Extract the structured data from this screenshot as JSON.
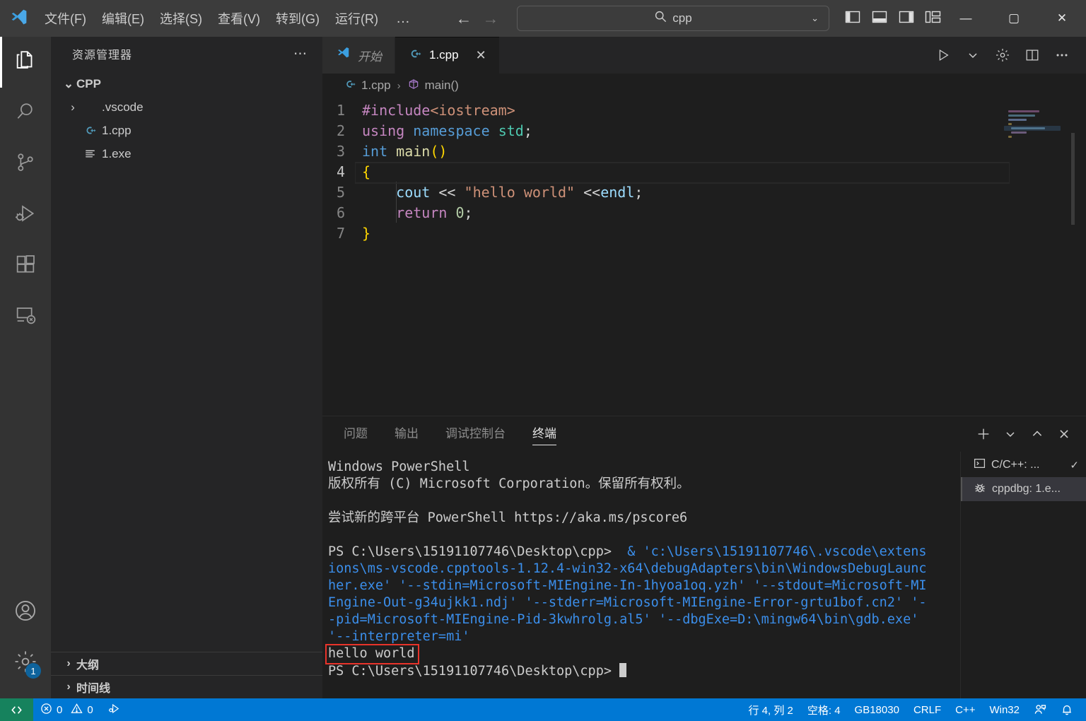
{
  "titlebar": {
    "logo": "vscode-logo",
    "menus": [
      "文件(F)",
      "编辑(E)",
      "选择(S)",
      "查看(V)",
      "转到(G)",
      "运行(R)"
    ],
    "more": "…",
    "nav_back": "←",
    "nav_forward": "→",
    "search": {
      "value": "cpp",
      "icon": "search-icon",
      "chevron": "⌄"
    },
    "layout_icons": [
      "toggle-primary-sidebar-icon",
      "toggle-panel-icon",
      "toggle-secondary-sidebar-icon",
      "customize-layout-icon"
    ],
    "window_controls": {
      "minimize": "—",
      "maximize": "▢",
      "close": "✕"
    }
  },
  "activitybar": {
    "items": [
      {
        "name": "explorer",
        "icon": "files-icon",
        "active": true
      },
      {
        "name": "search",
        "icon": "search-icon",
        "active": false
      },
      {
        "name": "source-control",
        "icon": "source-control-icon",
        "active": false
      },
      {
        "name": "run-and-debug",
        "icon": "run-debug-icon",
        "active": false
      },
      {
        "name": "extensions",
        "icon": "extensions-icon",
        "active": false
      },
      {
        "name": "remote-explorer",
        "icon": "remote-icon",
        "active": false
      }
    ],
    "bottom": [
      {
        "name": "accounts",
        "icon": "account-icon",
        "badge": ""
      },
      {
        "name": "settings",
        "icon": "gear-icon",
        "badge": "1"
      }
    ]
  },
  "sidebar": {
    "title": "资源管理器",
    "more": "⋯",
    "root": {
      "label": "CPP",
      "twisty": "⌄"
    },
    "files": [
      {
        "label": ".vscode",
        "twisty": "›",
        "icon": "folder-icon",
        "indent": 36
      },
      {
        "label": "1.cpp",
        "twisty": "",
        "icon": "cpp-file-icon",
        "indent": 36
      },
      {
        "label": "1.exe",
        "twisty": "",
        "icon": "exe-file-icon",
        "indent": 36
      }
    ],
    "sections": [
      {
        "label": "大纲",
        "twisty": "›"
      },
      {
        "label": "时间线",
        "twisty": "›"
      }
    ]
  },
  "editor": {
    "tabs": [
      {
        "label": "开始",
        "icon": "vscode-logo-icon",
        "active": false,
        "italic": true,
        "closable": false
      },
      {
        "label": "1.cpp",
        "icon": "cpp-file-icon",
        "active": true,
        "italic": false,
        "closable": true,
        "close": "✕"
      }
    ],
    "actions": [
      {
        "name": "run-code-button",
        "icon": "play-icon"
      },
      {
        "name": "run-options-dropdown",
        "icon": "chevron-down-icon"
      },
      {
        "name": "editor-settings-button",
        "icon": "gear-icon"
      },
      {
        "name": "split-editor-button",
        "icon": "split-editor-icon"
      },
      {
        "name": "more-actions-button",
        "icon": "ellipsis-icon"
      }
    ],
    "breadcrumb": [
      {
        "label": "1.cpp",
        "icon": "cpp-file-icon"
      },
      {
        "label": "main()",
        "icon": "symbol-method-icon"
      }
    ],
    "breadcrumb_separator": "›",
    "lines": [
      {
        "n": "1",
        "tokens": [
          {
            "t": "#include",
            "c": "t-pp"
          },
          {
            "t": "<iostream>",
            "c": "t-str2"
          }
        ]
      },
      {
        "n": "2",
        "tokens": [
          {
            "t": "using",
            "c": "t-kw"
          },
          {
            "t": " ",
            "c": "t-op"
          },
          {
            "t": "namespace",
            "c": "t-kw2"
          },
          {
            "t": " ",
            "c": "t-op"
          },
          {
            "t": "std",
            "c": "t-ns"
          },
          {
            "t": ";",
            "c": "t-op"
          }
        ]
      },
      {
        "n": "3",
        "tokens": [
          {
            "t": "int",
            "c": "t-kw2"
          },
          {
            "t": " ",
            "c": "t-op"
          },
          {
            "t": "main",
            "c": "t-fn"
          },
          {
            "t": "()",
            "c": "t-br"
          }
        ]
      },
      {
        "n": "4",
        "tokens": [
          {
            "t": "{",
            "c": "t-br"
          }
        ],
        "current": true
      },
      {
        "n": "5",
        "tokens": [
          {
            "t": "    ",
            "c": "t-op"
          },
          {
            "t": "cout",
            "c": "t-var"
          },
          {
            "t": " ",
            "c": "t-op"
          },
          {
            "t": "<<",
            "c": "t-op"
          },
          {
            "t": " ",
            "c": "t-op"
          },
          {
            "t": "\"hello world\"",
            "c": "t-str"
          },
          {
            "t": " ",
            "c": "t-op"
          },
          {
            "t": "<<",
            "c": "t-op"
          },
          {
            "t": "endl",
            "c": "t-var"
          },
          {
            "t": ";",
            "c": "t-op"
          }
        ]
      },
      {
        "n": "6",
        "tokens": [
          {
            "t": "    ",
            "c": "t-op"
          },
          {
            "t": "return",
            "c": "t-kw"
          },
          {
            "t": " ",
            "c": "t-op"
          },
          {
            "t": "0",
            "c": "t-num"
          },
          {
            "t": ";",
            "c": "t-op"
          }
        ]
      },
      {
        "n": "7",
        "tokens": [
          {
            "t": "}",
            "c": "t-br"
          }
        ]
      }
    ]
  },
  "panel": {
    "tabs": [
      {
        "label": "问题",
        "active": false
      },
      {
        "label": "输出",
        "active": false
      },
      {
        "label": "调试控制台",
        "active": false
      },
      {
        "label": "终端",
        "active": true
      }
    ],
    "actions": [
      {
        "name": "new-terminal-button",
        "icon": "plus-icon"
      },
      {
        "name": "terminal-profile-dropdown",
        "icon": "chevron-down-icon"
      },
      {
        "name": "maximize-panel-button",
        "icon": "chevron-up-icon"
      },
      {
        "name": "close-panel-button",
        "icon": "close-icon"
      }
    ],
    "terminal_lines": [
      {
        "text": "Windows PowerShell",
        "color": "default"
      },
      {
        "text": "版权所有 (C) Microsoft Corporation。保留所有权利。",
        "color": "default"
      },
      {
        "text": "",
        "color": "default"
      },
      {
        "text": "尝试新的跨平台 PowerShell https://aka.ms/pscore6",
        "color": "default"
      },
      {
        "text": "",
        "color": "default"
      },
      {
        "text": "PS C:\\Users\\15191107746\\Desktop\\cpp>  & 'c:\\Users\\15191107746\\.vscode\\extens",
        "color": "mixed",
        "prompt_len": 39
      },
      {
        "text": "ions\\ms-vscode.cpptools-1.12.4-win32-x64\\debugAdapters\\bin\\WindowsDebugLaunc",
        "color": "cyan"
      },
      {
        "text": "her.exe' '--stdin=Microsoft-MIEngine-In-1hyoa1oq.yzh' '--stdout=Microsoft-MI",
        "color": "cyan"
      },
      {
        "text": "Engine-Out-g34ujkk1.ndj' '--stderr=Microsoft-MIEngine-Error-grtu1bof.cn2' '-",
        "color": "cyan"
      },
      {
        "text": "-pid=Microsoft-MIEngine-Pid-3kwhrolg.al5' '--dbgExe=D:\\mingw64\\bin\\gdb.exe'",
        "color": "cyan"
      },
      {
        "text": "'--interpreter=mi'",
        "color": "cyan"
      }
    ],
    "output_highlight": "hello world",
    "last_prompt": "PS C:\\Users\\15191107746\\Desktop\\cpp> ",
    "terminal_list": [
      {
        "label": "C/C++: ...",
        "icon": "terminal-icon",
        "selected": false,
        "check": "✓"
      },
      {
        "label": "cppdbg: 1.e...",
        "icon": "debug-icon",
        "selected": true,
        "check": ""
      }
    ]
  },
  "statusbar": {
    "remote_icon": "remote-indicator-icon",
    "errors": {
      "icon": "error-icon",
      "count": "0"
    },
    "warnings": {
      "icon": "warning-icon",
      "count": "0"
    },
    "debug_icon": "debug-alt-icon",
    "right": [
      {
        "label": "行 4, 列 2",
        "name": "cursor-position"
      },
      {
        "label": "空格: 4",
        "name": "indentation"
      },
      {
        "label": "GB18030",
        "name": "encoding"
      },
      {
        "label": "CRLF",
        "name": "eol"
      },
      {
        "label": "C++",
        "name": "language-mode"
      },
      {
        "label": "Win32",
        "name": "platform"
      }
    ],
    "feedback_icon": "feedback-icon",
    "bell_icon": "bell-icon"
  },
  "colors": {
    "accent": "#0078d4",
    "remote_green": "#16825d",
    "highlight_red": "#e8332a",
    "badge_blue": "#0e639c"
  }
}
